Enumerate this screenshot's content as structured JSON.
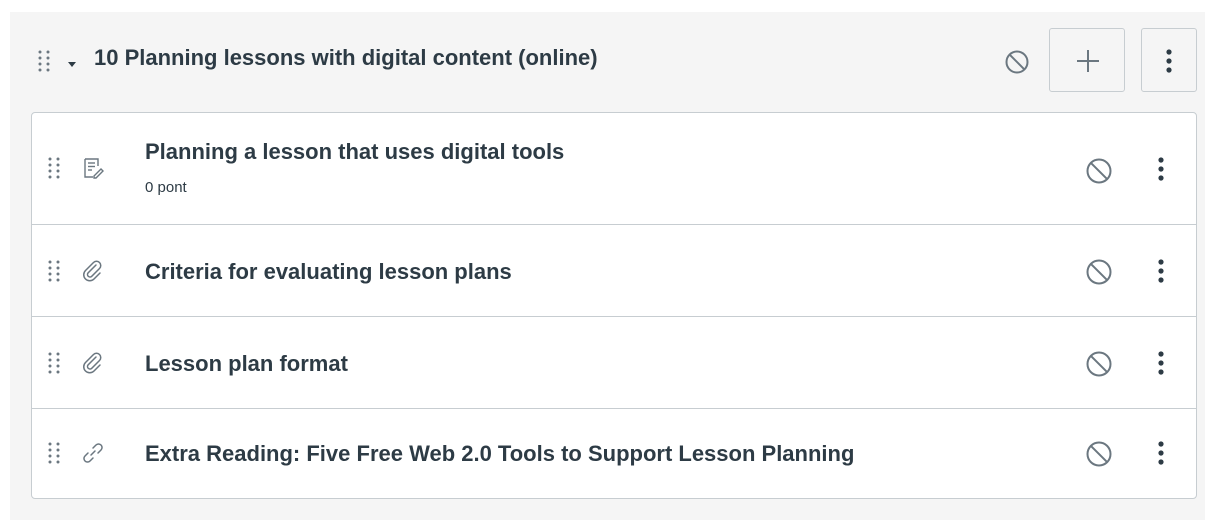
{
  "module": {
    "title": "10 Planning lessons with digital content (online)",
    "icons": {
      "drag": "drag-handle-icon",
      "collapse": "caret-down-icon",
      "status": "unpublished-icon",
      "add": "plus-icon",
      "menu": "kebab-menu-icon"
    }
  },
  "items": [
    {
      "type_icon": "assignment-icon",
      "title": "Planning a lesson that uses digital tools",
      "subtitle": "0 pont"
    },
    {
      "type_icon": "attachment-icon",
      "title": "Criteria for evaluating lesson plans"
    },
    {
      "type_icon": "attachment-icon",
      "title": "Lesson plan format"
    },
    {
      "type_icon": "link-icon",
      "title": "Extra Reading: Five Free Web 2.0 Tools to Support Lesson Planning"
    }
  ],
  "colors": {
    "text": "#2d3b45",
    "icon": "#6b7780",
    "border": "#c7cdd1",
    "module_bg": "#f5f5f5"
  }
}
